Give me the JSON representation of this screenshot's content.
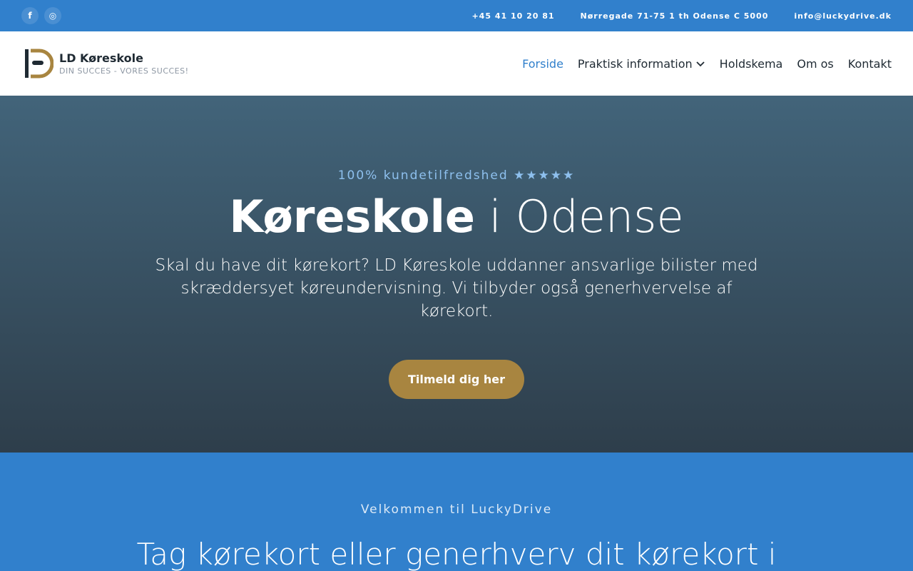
{
  "topbar": {
    "social": [
      {
        "icon": "facebook-icon",
        "glyph": "f"
      },
      {
        "icon": "instagram-icon",
        "glyph": "◎"
      }
    ],
    "phone": "+45 41 10 20 81",
    "address": "Nørregade 71-75 1 th Odense C 5000",
    "email": "info@luckydrive.dk"
  },
  "header": {
    "logo_name": "LD Køreskole",
    "logo_tagline": "DIN SUCCES - VORES SUCCES!",
    "nav": [
      {
        "label": "Forside",
        "active": true
      },
      {
        "label": "Praktisk information",
        "has_dropdown": true
      },
      {
        "label": "Holdskema"
      },
      {
        "label": "Om os"
      },
      {
        "label": "Kontakt"
      }
    ]
  },
  "hero": {
    "eyebrow": "100% kundetilfredshed ★★★★★",
    "title_bold": "Køreskole",
    "title_rest": " i Odense",
    "description": "Skal du have dit kørekort? LD Køreskole uddanner ansvarlige bilister med skræddersyet køreundervisning. Vi tilbyder også generhvervelse af kørekort.",
    "cta_label": "Tilmeld dig her"
  },
  "welcome": {
    "eyebrow": "Velkommen til LuckyDrive",
    "title": "Tag kørekort eller generhverv dit kørekort i"
  },
  "colors": {
    "primary": "#3180cc",
    "accent_gold": "#a88540",
    "hero_top": "#42647a",
    "hero_bottom": "#2e3e4b"
  }
}
